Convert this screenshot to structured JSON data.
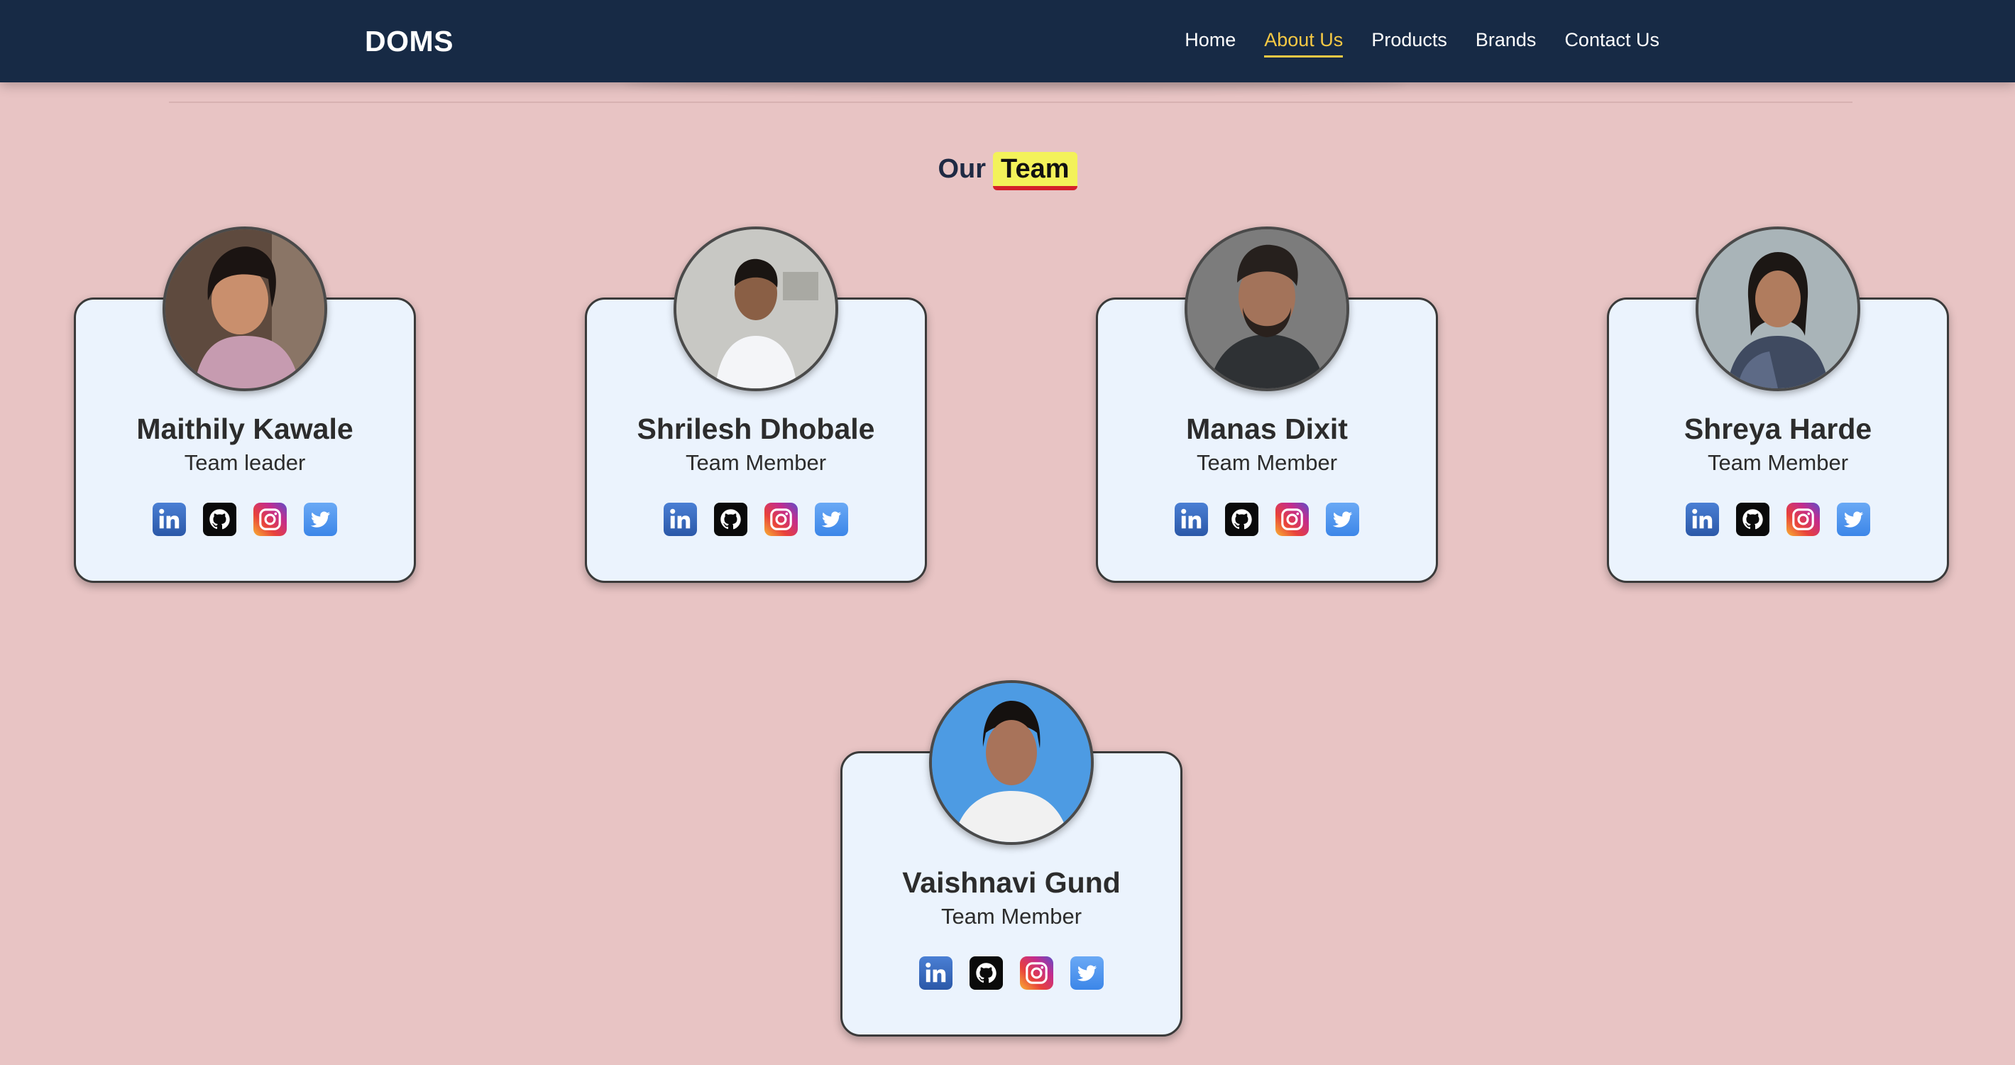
{
  "nav": {
    "brand": "DOMS",
    "links": [
      {
        "label": "Home",
        "active": false
      },
      {
        "label": "About Us",
        "active": true
      },
      {
        "label": "Products",
        "active": false
      },
      {
        "label": "Brands",
        "active": false
      },
      {
        "label": "Contact Us",
        "active": false
      }
    ]
  },
  "heading": {
    "prefix": "Our",
    "highlight": "Team"
  },
  "team": [
    {
      "name": "Maithily Kawale",
      "role": "Team leader",
      "avatar_bg": "#5a4a40",
      "social": [
        "linkedin-icon",
        "github-icon",
        "instagram-icon",
        "twitter-icon"
      ]
    },
    {
      "name": "Shrilesh Dhobale",
      "role": "Team Member",
      "avatar_bg": "#c9c9c6",
      "social": [
        "linkedin-icon",
        "github-icon",
        "instagram-icon",
        "twitter-icon"
      ]
    },
    {
      "name": "Manas Dixit",
      "role": "Team Member",
      "avatar_bg": "#7b7b7b",
      "social": [
        "linkedin-icon",
        "github-icon",
        "instagram-icon",
        "twitter-icon"
      ]
    },
    {
      "name": "Shreya Harde",
      "role": "Team Member",
      "avatar_bg": "#a9b4b8",
      "social": [
        "linkedin-icon",
        "github-icon",
        "instagram-icon",
        "twitter-icon"
      ]
    },
    {
      "name": "Vaishnavi Gund",
      "role": "Team Member",
      "avatar_bg": "#4d9be3",
      "social": [
        "linkedin-icon",
        "github-icon",
        "instagram-icon",
        "twitter-icon"
      ]
    }
  ],
  "colors": {
    "page_bg": "#e8c4c4",
    "navbar_bg": "#172a45",
    "nav_active": "#f6c944",
    "card_bg": "#ebf3fd",
    "highlight_bg": "#f3f25a",
    "highlight_underline": "#d4202a"
  }
}
